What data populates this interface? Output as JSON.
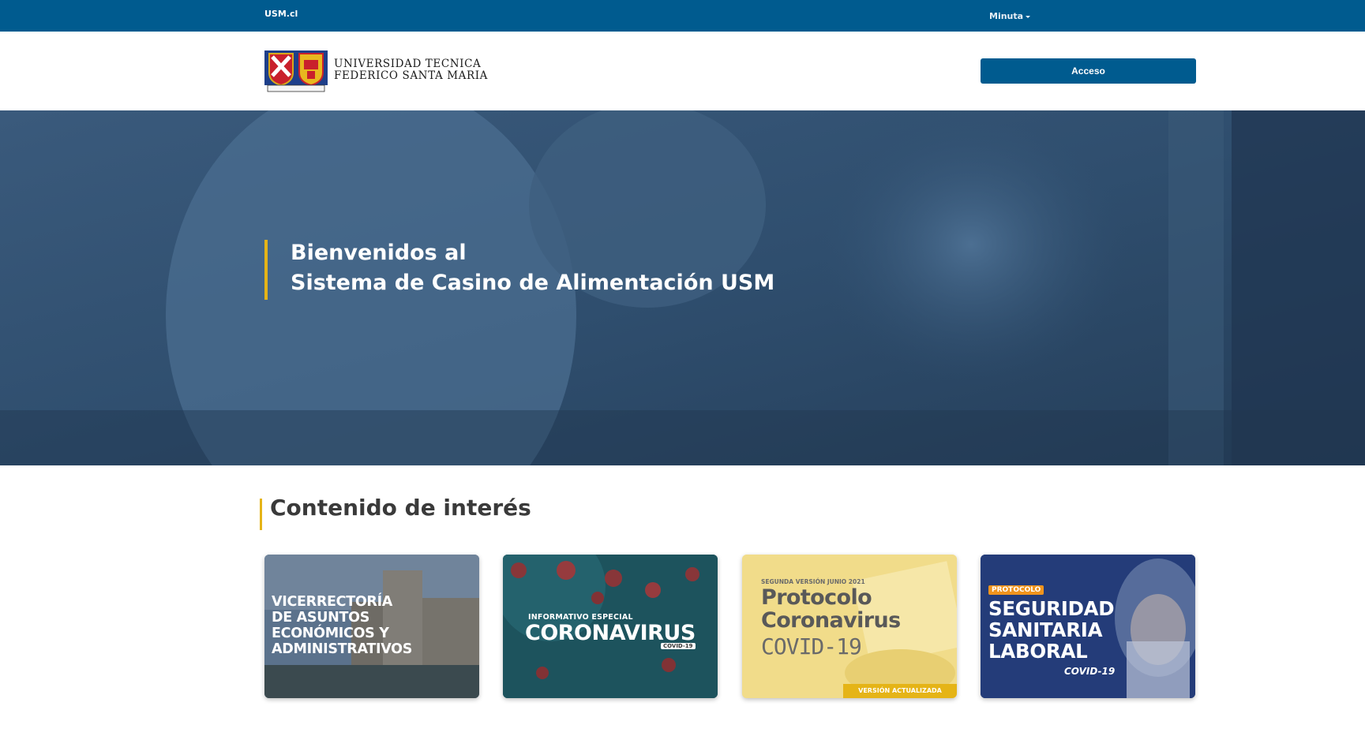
{
  "topbar": {
    "brand_link": "USM.cl",
    "menu_label": "Minuta"
  },
  "header": {
    "logo_line1": "UNIVERSIDAD TECNICA",
    "logo_line2": "FEDERICO SANTA MARIA",
    "access_button": "Acceso"
  },
  "hero": {
    "title_line1": "Bienvenidos al",
    "title_line2": "Sistema de Casino de Alimentación USM"
  },
  "section": {
    "title": "Contenido de interés"
  },
  "cards": [
    {
      "lines": [
        "VICERRECTORÍA",
        "DE ASUNTOS",
        "ECONÓMICOS Y",
        "ADMINISTRATIVOS"
      ]
    },
    {
      "kicker": "INFORMATIVO ESPECIAL",
      "title": "CORONAVIRUS",
      "badge": "COVID-19"
    },
    {
      "kicker": "SEGUNDA VERSIÓN JUNIO 2021",
      "title_line1": "Protocolo",
      "title_line2": "Coronavirus",
      "title_line3": "COVID-19",
      "ribbon": "VERSIÓN ACTUALIZADA"
    },
    {
      "tag": "PROTOCOLO",
      "title_line1": "SEGURIDAD",
      "title_line2": "SANITARIA",
      "title_line3": "LABORAL",
      "subtitle": "COVID-19"
    }
  ],
  "colors": {
    "primary": "#005b8f",
    "accent": "#e5b417",
    "text_dark": "#3a3a3a"
  }
}
